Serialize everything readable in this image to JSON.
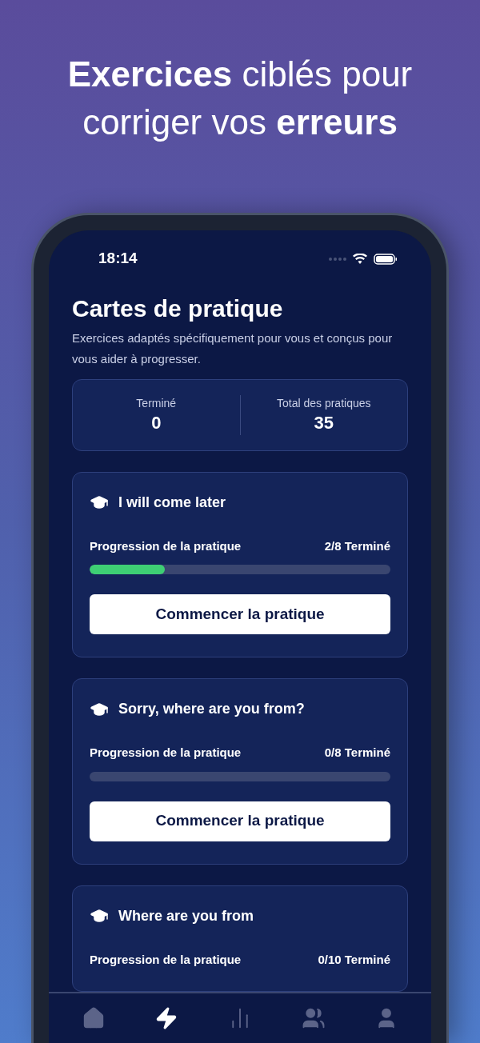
{
  "headline": "**Exercices** ciblés pour corriger vos **erreurs**",
  "status_bar": {
    "time": "18:14"
  },
  "page": {
    "title": "Cartes de pratique",
    "subtitle": "Exercices adaptés spécifiquement pour vous et conçus pour vous aider à progresser."
  },
  "stats": [
    {
      "label": "Terminé",
      "value": "0"
    },
    {
      "label": "Total des pratiques",
      "value": "35"
    }
  ],
  "cards": [
    {
      "title": "I will come later",
      "progress_label": "Progression de la pratique",
      "count": "2/8 Terminé",
      "level": 0.25,
      "button": "Commencer la pratique"
    },
    {
      "title": "Sorry, where are you from?",
      "progress_label": "Progression de la pratique",
      "count": "0/8 Terminé",
      "level": 0,
      "button": "Commencer la pratique"
    },
    {
      "title": "Where are you from",
      "progress_label": "Progression de la pratique",
      "count": "0/10 Terminé"
    }
  ],
  "tab_bar": [
    {
      "kind": "home",
      "selected": false
    },
    {
      "kind": "practice",
      "selected": true
    },
    {
      "kind": "stats",
      "selected": false
    },
    {
      "kind": "community",
      "selected": false
    },
    {
      "kind": "profile",
      "selected": false
    }
  ]
}
